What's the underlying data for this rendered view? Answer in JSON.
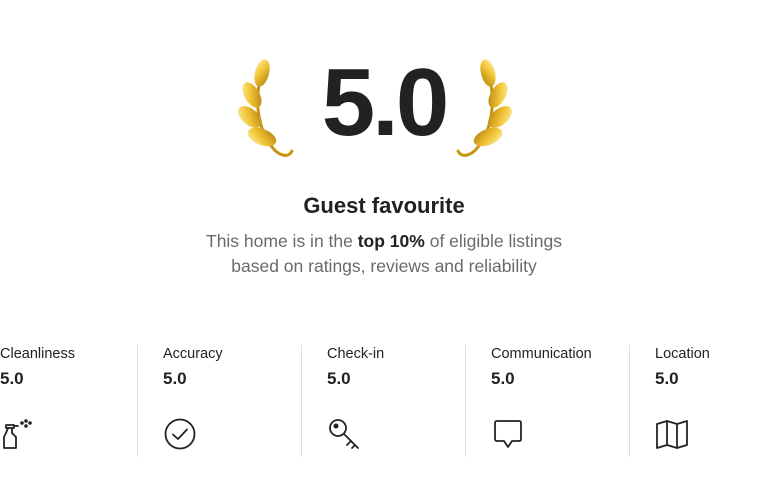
{
  "rating": {
    "overall": "5.0",
    "headline": "Guest favourite",
    "description_line1_pre": "This home is in the ",
    "description_line1_bold": "top 10%",
    "description_line1_post": " of eligible listings",
    "description_line2": "based on ratings, reviews and reliability"
  },
  "categories": [
    {
      "label": "Cleanliness",
      "value": "5.0",
      "icon": "spray-bottle-icon"
    },
    {
      "label": "Accuracy",
      "value": "5.0",
      "icon": "check-circle-icon"
    },
    {
      "label": "Check-in",
      "value": "5.0",
      "icon": "key-icon"
    },
    {
      "label": "Communication",
      "value": "5.0",
      "icon": "chat-bubble-icon"
    },
    {
      "label": "Location",
      "value": "5.0",
      "icon": "map-icon"
    }
  ],
  "colors": {
    "text": "#222222",
    "muted": "#6a6a6a",
    "divider": "#dddddd",
    "laurel": "#d9a520"
  }
}
